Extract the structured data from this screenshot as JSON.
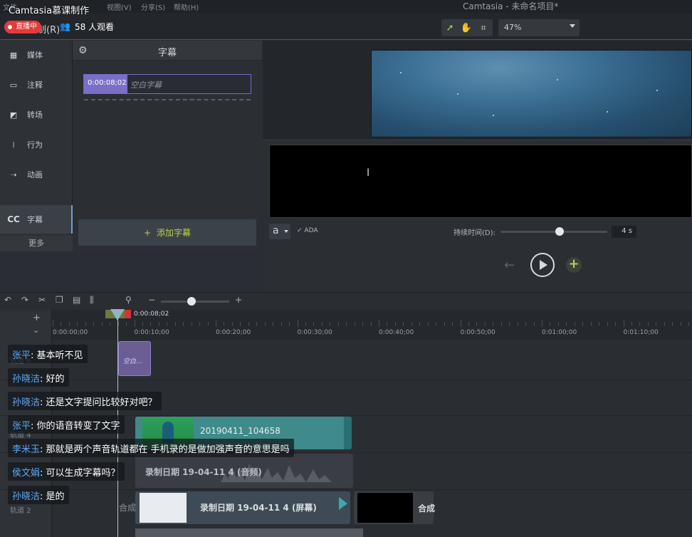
{
  "stream": {
    "title": "Camtasia慕课制作",
    "live_label": "直播中",
    "record_label": "制(R)",
    "viewers": "58 人观看"
  },
  "menu": [
    "文件",
    "视图(V)",
    "分享(S)",
    "帮助(H)"
  ],
  "app_title": "Camtasia - 未命名项目*",
  "toolbar": {
    "zoom": "47%"
  },
  "sidebar": {
    "items": [
      {
        "label": "媒体",
        "icon": "media-icon"
      },
      {
        "label": "注释",
        "icon": "annotation-icon"
      },
      {
        "label": "转场",
        "icon": "transition-icon"
      },
      {
        "label": "行为",
        "icon": "behavior-icon"
      },
      {
        "label": "动画",
        "icon": "animation-icon"
      },
      {
        "label": "字幕",
        "icon": "cc-icon",
        "active": true
      }
    ],
    "more": "更多"
  },
  "captions_panel": {
    "title": "字幕",
    "entry_time": "0:00:08;02",
    "entry_placeholder": "空白字幕",
    "add_button": "添加字幕"
  },
  "editor": {
    "font_glyph": "a",
    "ada": "ADA",
    "duration_label": "持续时间(D):",
    "duration_value": "4 s",
    "duration_fraction": 0.55
  },
  "timeline": {
    "playhead_time": "0:00:08;02",
    "ruler": [
      "0:00:00;00",
      "0:00:10;00",
      "0:00:20;00",
      "0:00:30;00",
      "0:00:40;00",
      "0:00:50;00",
      "0:01:00;00",
      "0:01:10;00"
    ],
    "zoom_fraction": 0.45,
    "tracks": [
      "轨道 6",
      "轨道 4",
      "轨道 2"
    ],
    "clips": {
      "caption": "空白...",
      "video": "20190411_104658",
      "audio": "录制日期 19-04-11 4 (音频)",
      "screen": "录制日期 19-04-11 4 (屏幕)",
      "group": "合成",
      "group_left": "合成"
    }
  },
  "chat": [
    {
      "user": "张平",
      "text": ": 基本听不见"
    },
    {
      "user": "孙晓洁",
      "text": ": 好的"
    },
    {
      "user": "孙晓洁",
      "text": ": 还是文字提问比较好对吧？"
    },
    {
      "user": "张平",
      "text": ": 你的语音转变了文字"
    },
    {
      "user": "李米玉",
      "text": ": 那就是两个声音轨道都在 手机录的是做加强声音的意思是吗"
    },
    {
      "user": "侯文娟",
      "text": ": 可以生成字幕吗？"
    },
    {
      "user": "孙晓洁",
      "text": ": 是的"
    }
  ],
  "colors": {
    "accent_green": "#b6d24a",
    "caption_purple": "#7a6fc6",
    "live_red": "#e23b3b",
    "chat_name": "#5fa8f5"
  }
}
